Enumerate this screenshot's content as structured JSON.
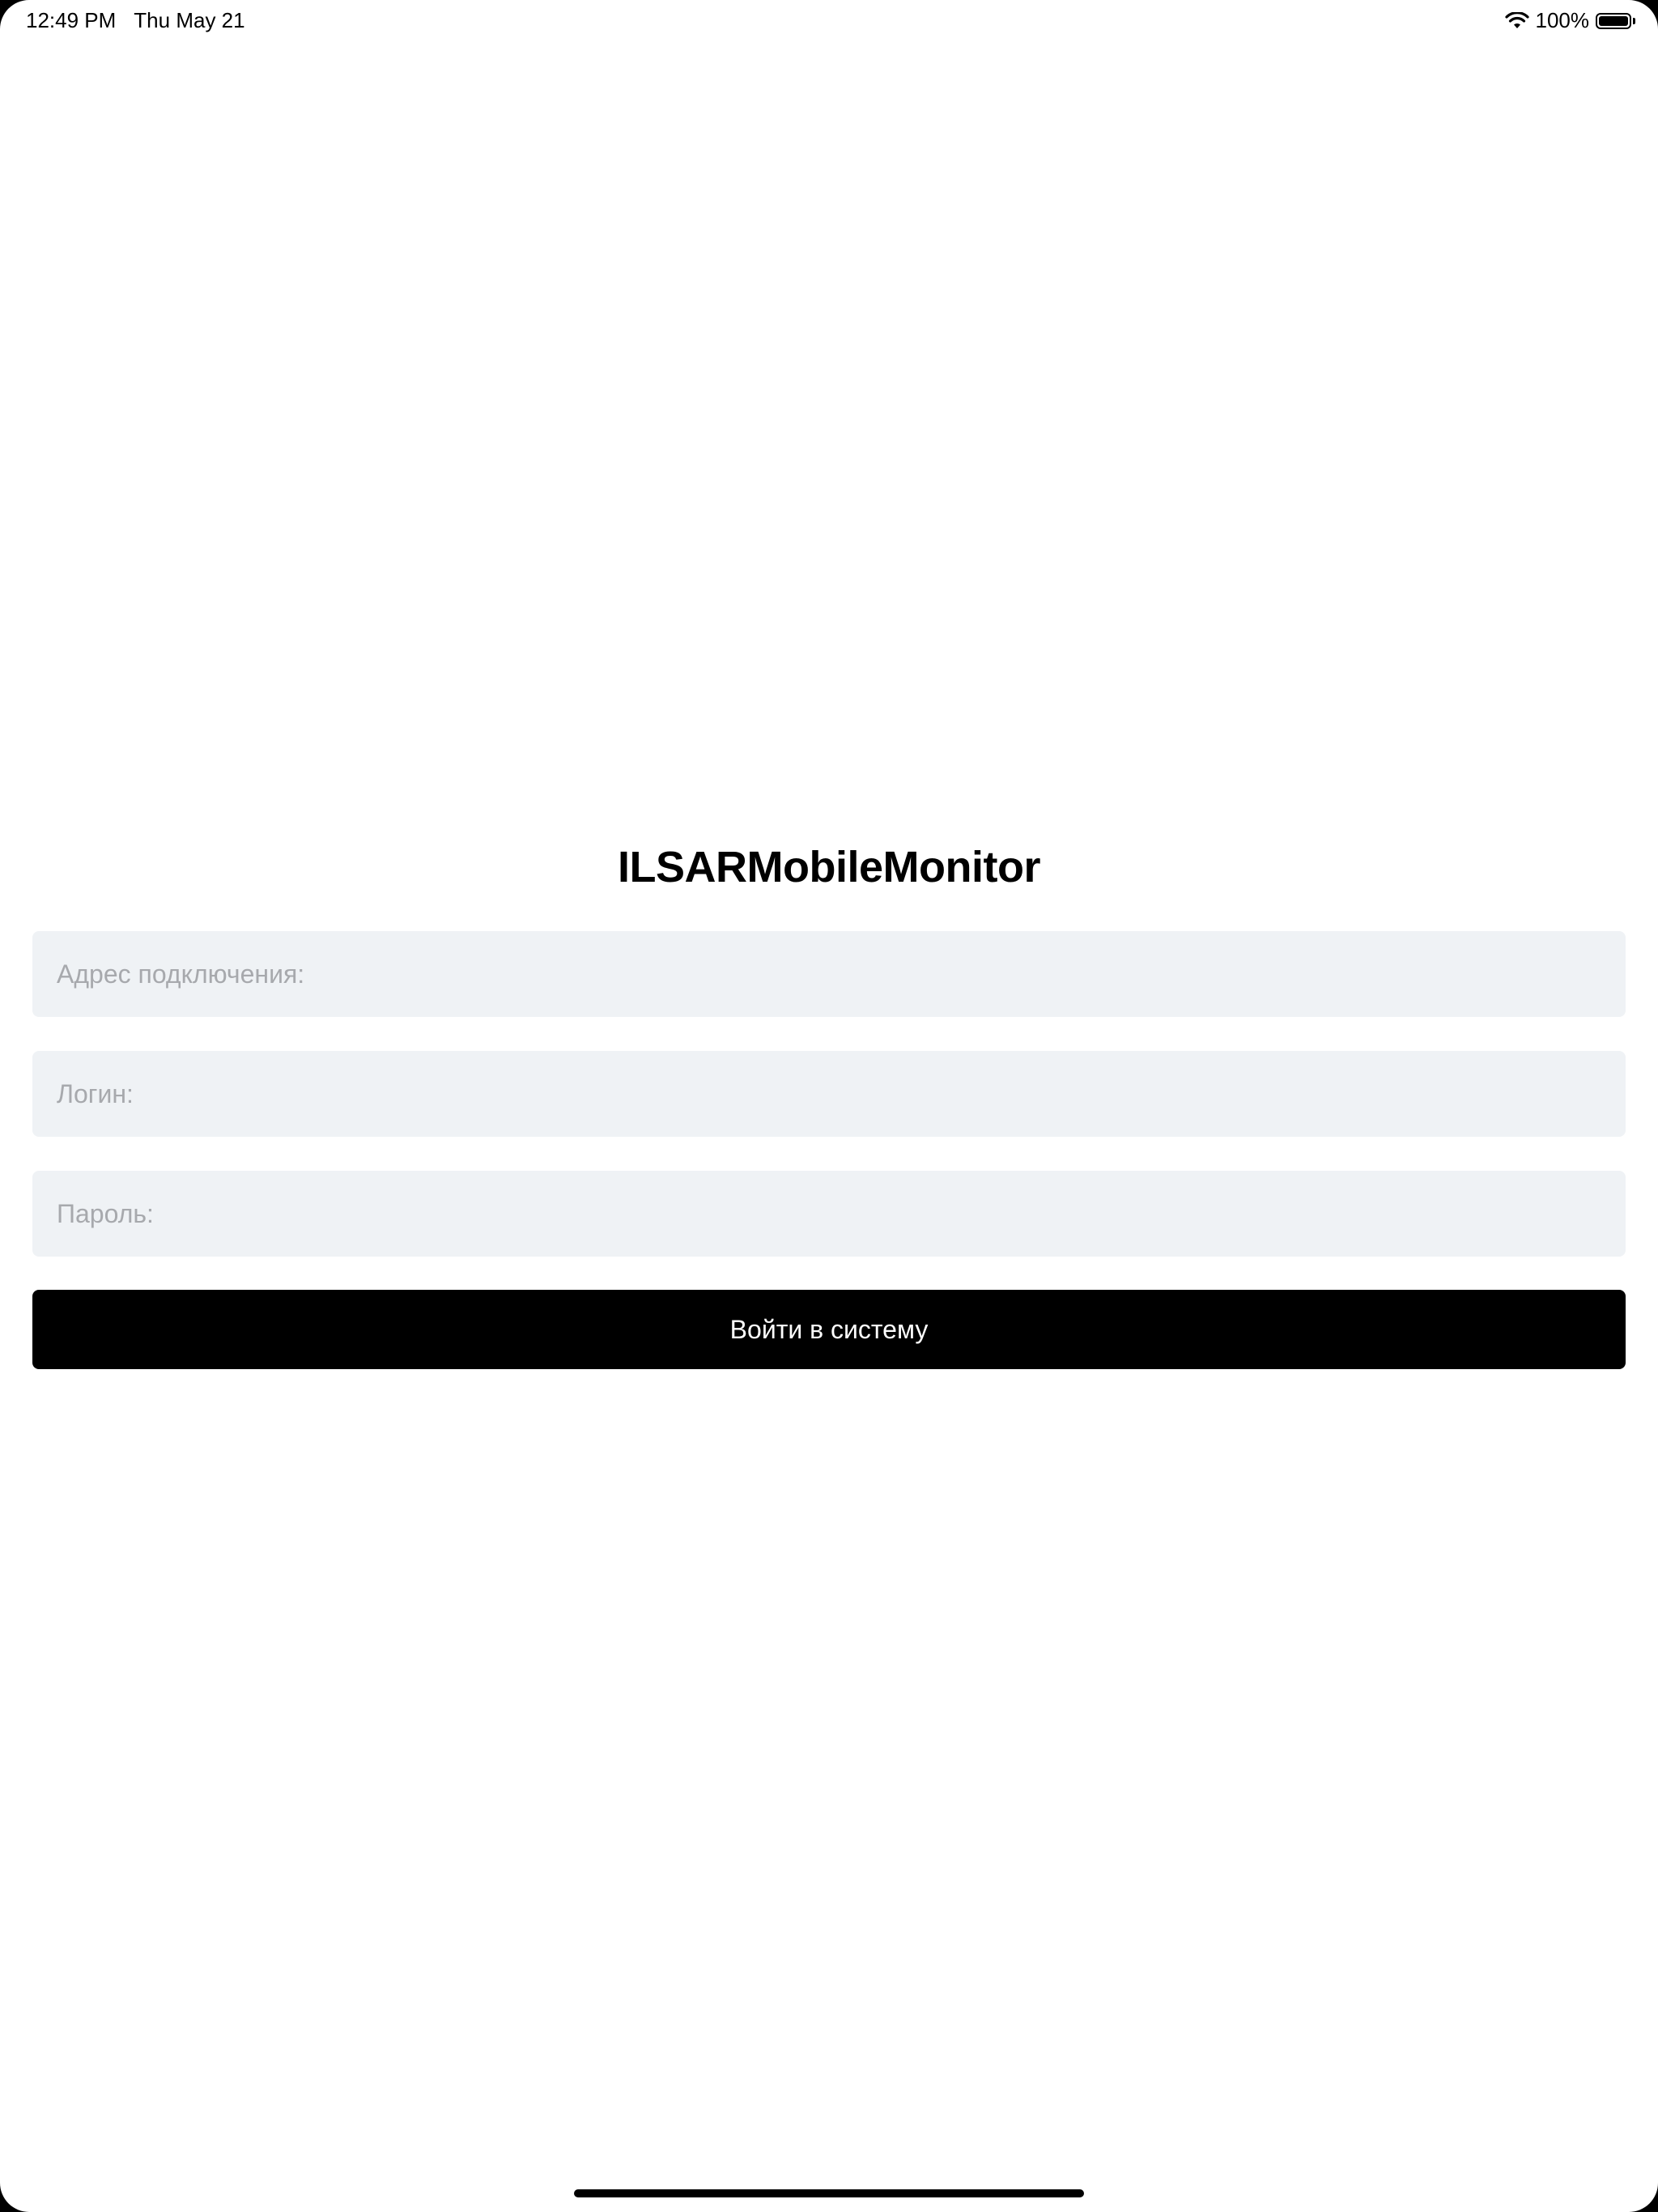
{
  "status_bar": {
    "time": "12:49 PM",
    "date": "Thu May 21",
    "battery_percent": "100%",
    "battery_level": 1.0,
    "icons": [
      "wifi-icon",
      "battery-icon"
    ]
  },
  "login": {
    "title": "ILSARMobileMonitor",
    "address_placeholder": "Адрес подключения:",
    "address_value": "",
    "login_placeholder": "Логин:",
    "login_value": "",
    "password_placeholder": "Пароль:",
    "password_value": "",
    "submit_label": "Войти в систему"
  },
  "colors": {
    "background": "#ffffff",
    "field_background": "#eff2f5",
    "placeholder": "#a7a9ad",
    "button_background": "#000000",
    "button_text": "#ffffff"
  }
}
